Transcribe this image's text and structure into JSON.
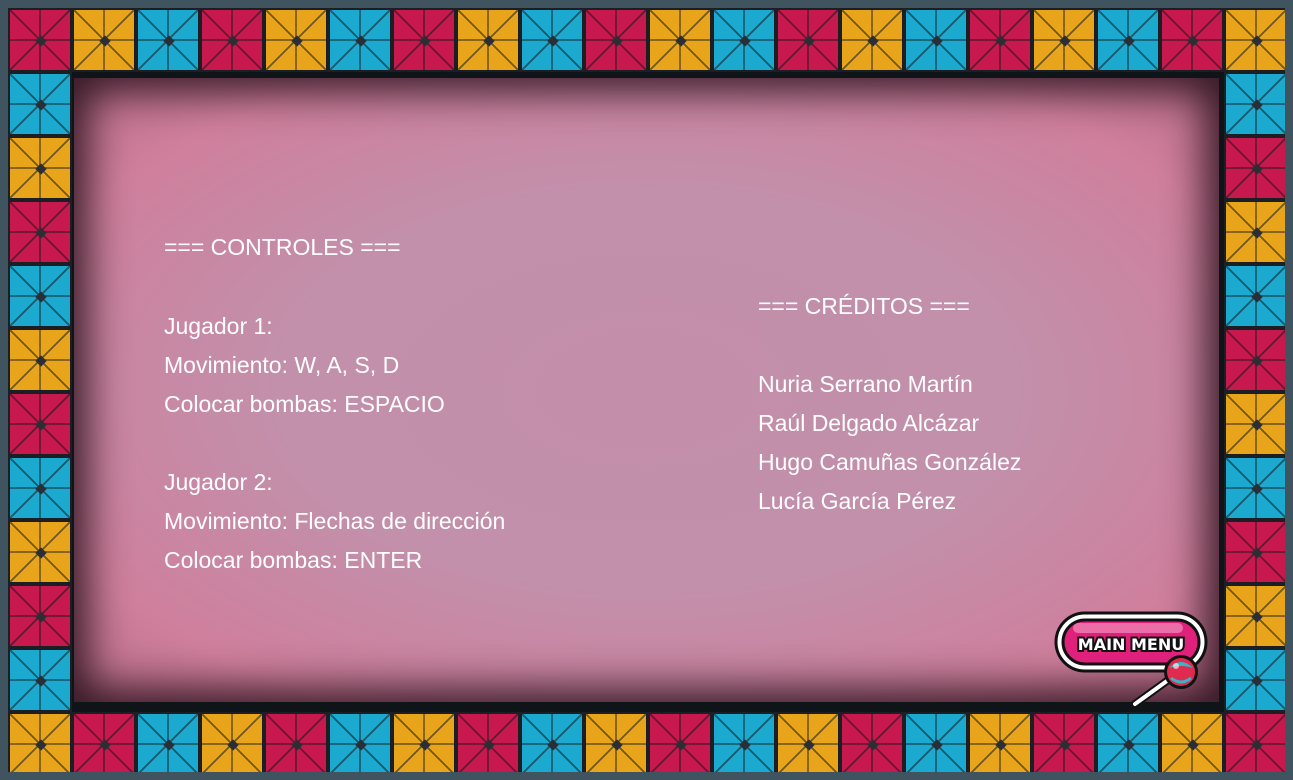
{
  "colors": {
    "tile_pattern": [
      "#c8194f",
      "#e8a51c",
      "#1ba9cf"
    ],
    "panel": "#c38eaa",
    "button_fill": "#e0217c",
    "button_outline": "#111111",
    "text": "#ffffff"
  },
  "controls": {
    "header": "=== CONTROLES ===",
    "player1": {
      "title": "Jugador 1:",
      "movement": "Movimiento: W, A, S, D",
      "bombs": "Colocar bombas: ESPACIO"
    },
    "player2": {
      "title": "Jugador 2:",
      "movement": "Movimiento: Flechas de dirección",
      "bombs": "Colocar bombas: ENTER"
    }
  },
  "credits": {
    "header": "=== CRÉDITOS ===",
    "names": [
      "Nuria Serrano Martín",
      "Raúl Delgado Alcázar",
      "Hugo Camuñas González",
      "Lucía García Pérez"
    ]
  },
  "main_menu_button": {
    "label": "MAIN MENU",
    "icon": "lollipop-icon"
  }
}
